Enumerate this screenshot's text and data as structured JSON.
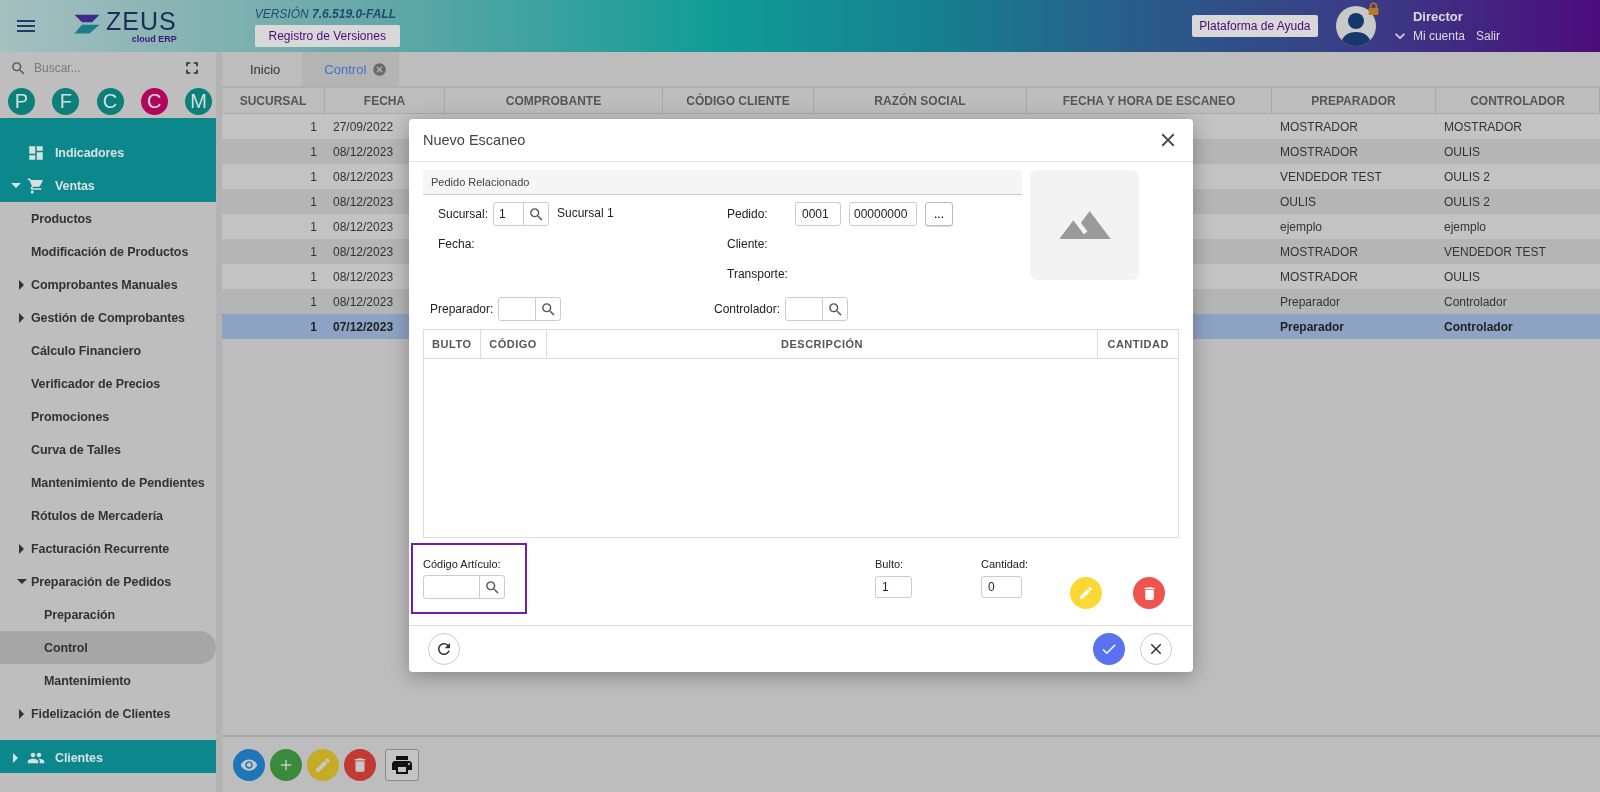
{
  "header": {
    "logo": {
      "name": "ZEUS",
      "subtitle": "cloud ERP"
    },
    "version": "VERSIÓN **7.6.519.0-FALL**",
    "versions_button": "Registro de Versiones",
    "help_button": "Plataforma de Ayuda",
    "user": {
      "name": "Director",
      "account_link": "Mi cuenta",
      "logout_link": "Salir"
    }
  },
  "sidebar": {
    "search": {
      "placeholder": "Buscar..."
    },
    "shortcuts": [
      {
        "letter": "P",
        "color": "#0b7f79"
      },
      {
        "letter": "F",
        "color": "#0b7f79"
      },
      {
        "letter": "C",
        "color": "#0b7f79"
      },
      {
        "letter": "C",
        "color": "#b0065e"
      },
      {
        "letter": "M",
        "color": "#0b7f79"
      }
    ],
    "items": [
      {
        "label": "Indicadores",
        "selected": false
      },
      {
        "label": "Ventas",
        "selected": false,
        "expanded": true,
        "children": [
          {
            "label": "Productos",
            "selected": false
          },
          {
            "label": "Modificación de Productos",
            "selected": false
          },
          {
            "label": "Comprobantes Manuales",
            "selected": false,
            "expanded": false
          },
          {
            "label": "Gestión de Comprobantes",
            "selected": false,
            "expanded": false
          },
          {
            "label": "Cálculo Financiero",
            "selected": false
          },
          {
            "label": "Verificador de Precios",
            "selected": false
          },
          {
            "label": "Promociones",
            "selected": false
          },
          {
            "label": "Curva de Talles",
            "selected": false
          },
          {
            "label": "Mantenimiento de Pendientes",
            "selected": false
          },
          {
            "label": "Rótulos de Mercadería",
            "selected": false
          },
          {
            "label": "Facturación Recurrente",
            "selected": false,
            "expanded": false
          },
          {
            "label": "Preparación de Pedidos",
            "selected": false,
            "expanded": true,
            "children": [
              {
                "label": "Preparación",
                "selected": false
              },
              {
                "label": "Control",
                "selected": true
              },
              {
                "label": "Mantenimiento",
                "selected": false
              }
            ]
          },
          {
            "label": "Fidelización de Clientes",
            "selected": false,
            "expanded": false
          }
        ]
      },
      {
        "label": "Clientes",
        "selected": false,
        "expanded": false
      }
    ]
  },
  "tabs": [
    {
      "label": "Inicio",
      "selected": false,
      "closable": false
    },
    {
      "label": "Control",
      "selected": true,
      "closable": true
    }
  ],
  "table": {
    "columns": [
      "SUCURSAL",
      "FECHA",
      "COMPROBANTE",
      "CÓDIGO CLIENTE",
      "RAZÓN SOCIAL",
      "FECHA Y HORA DE ESCANEO",
      "PREPARADOR",
      "CONTROLADOR"
    ],
    "rows": [
      {
        "sucursal": "1",
        "fecha": "27/09/2022",
        "preparador": "MOSTRADOR",
        "controlador": "MOSTRADOR",
        "selected": false
      },
      {
        "sucursal": "1",
        "fecha": "08/12/2023",
        "preparador": "MOSTRADOR",
        "controlador": "OULIS",
        "selected": false
      },
      {
        "sucursal": "1",
        "fecha": "08/12/2023",
        "preparador": "VENDEDOR TEST",
        "controlador": "OULIS 2",
        "selected": false
      },
      {
        "sucursal": "1",
        "fecha": "08/12/2023",
        "preparador": "OULIS",
        "controlador": "OULIS 2",
        "selected": false
      },
      {
        "sucursal": "1",
        "fecha": "08/12/2023",
        "preparador": "ejemplo",
        "controlador": "ejemplo",
        "selected": false
      },
      {
        "sucursal": "1",
        "fecha": "08/12/2023",
        "preparador": "MOSTRADOR",
        "controlador": "VENDEDOR TEST",
        "selected": false
      },
      {
        "sucursal": "1",
        "fecha": "08/12/2023",
        "preparador": "MOSTRADOR",
        "controlador": "OULIS",
        "selected": false
      },
      {
        "sucursal": "1",
        "fecha": "08/12/2023",
        "preparador": "Preparador",
        "controlador": "Controlador",
        "selected": false
      },
      {
        "sucursal": "1",
        "fecha": "07/12/2023",
        "preparador": "Preparador",
        "controlador": "Controlador",
        "selected": true
      }
    ]
  },
  "toolbar": [
    {
      "kind": "view"
    },
    {
      "kind": "add"
    },
    {
      "kind": "edit"
    },
    {
      "kind": "delete"
    },
    {
      "kind": "print"
    }
  ],
  "modal": {
    "title": "Nuevo Escaneo",
    "section_title": "Pedido Relacionado",
    "sucursal": {
      "label": "Sucursal:",
      "value": "1",
      "name": "Sucursal 1"
    },
    "pedido": {
      "label": "Pedido:",
      "point": "0001",
      "number": "00000000",
      "more_button": "..."
    },
    "fecha_label": "Fecha:",
    "cliente_label": "Cliente:",
    "transporte_label": "Transporte:",
    "preparador": {
      "label": "Preparador:"
    },
    "controlador": {
      "label": "Controlador:"
    },
    "items_columns": [
      "BULTO",
      "CÓDIGO",
      "DESCRIPCIÓN",
      "CANTIDAD"
    ],
    "article": {
      "label": "Código Artículo:"
    },
    "bulto": {
      "label": "Bulto:",
      "value": "1"
    },
    "cantidad": {
      "label": "Cantidad:",
      "value": "0"
    }
  }
}
